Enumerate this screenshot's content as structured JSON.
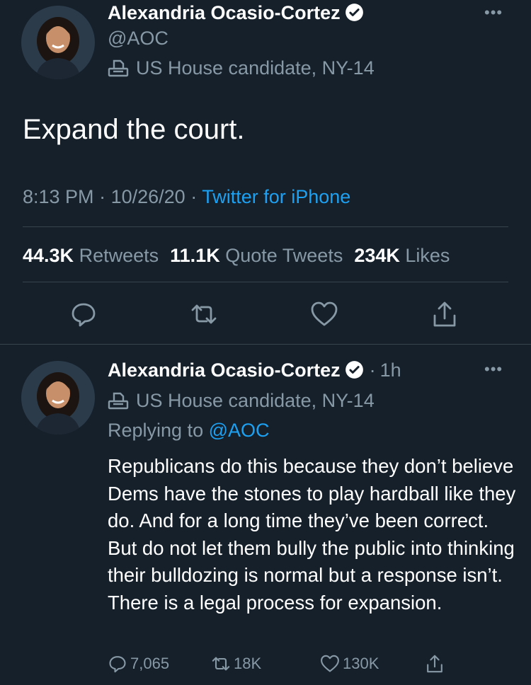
{
  "main_tweet": {
    "author": {
      "name": "Alexandria Ocasio-Cortez",
      "handle": "@AOC",
      "label": "US House candidate, NY-14"
    },
    "more_icon": "more-dots-icon",
    "text": "Expand the court.",
    "time": "8:13 PM",
    "date": "10/26/20",
    "separator": "·",
    "source": "Twitter for iPhone",
    "stats": {
      "retweets_count": "44.3K",
      "retweets_label": "Retweets",
      "quotes_count": "11.1K",
      "quotes_label": "Quote Tweets",
      "likes_count": "234K",
      "likes_label": "Likes"
    },
    "actions": [
      "reply-icon",
      "retweet-icon",
      "like-icon",
      "share-icon"
    ]
  },
  "reply_tweet": {
    "author": {
      "name": "Alexandria Ocasio-Cortez",
      "time_ago": "1h",
      "label": "US House candidate, NY-14"
    },
    "replying_to_prefix": "Replying to",
    "replying_to_handle": "@AOC",
    "text": "Republicans do this because they don’t believe Dems have the stones to play hardball like they do. And for a long time they’ve been correct. But do not let them bully the public into thinking their bulldozing is normal but a response isn’t. There is a legal process for expansion.",
    "counts": {
      "replies": "7,065",
      "retweets": "18K",
      "likes": "130K"
    }
  },
  "colors": {
    "background": "#15202b",
    "text": "#ffffff",
    "muted": "#8899a6",
    "link": "#1da1f2",
    "divider": "#38444d"
  }
}
